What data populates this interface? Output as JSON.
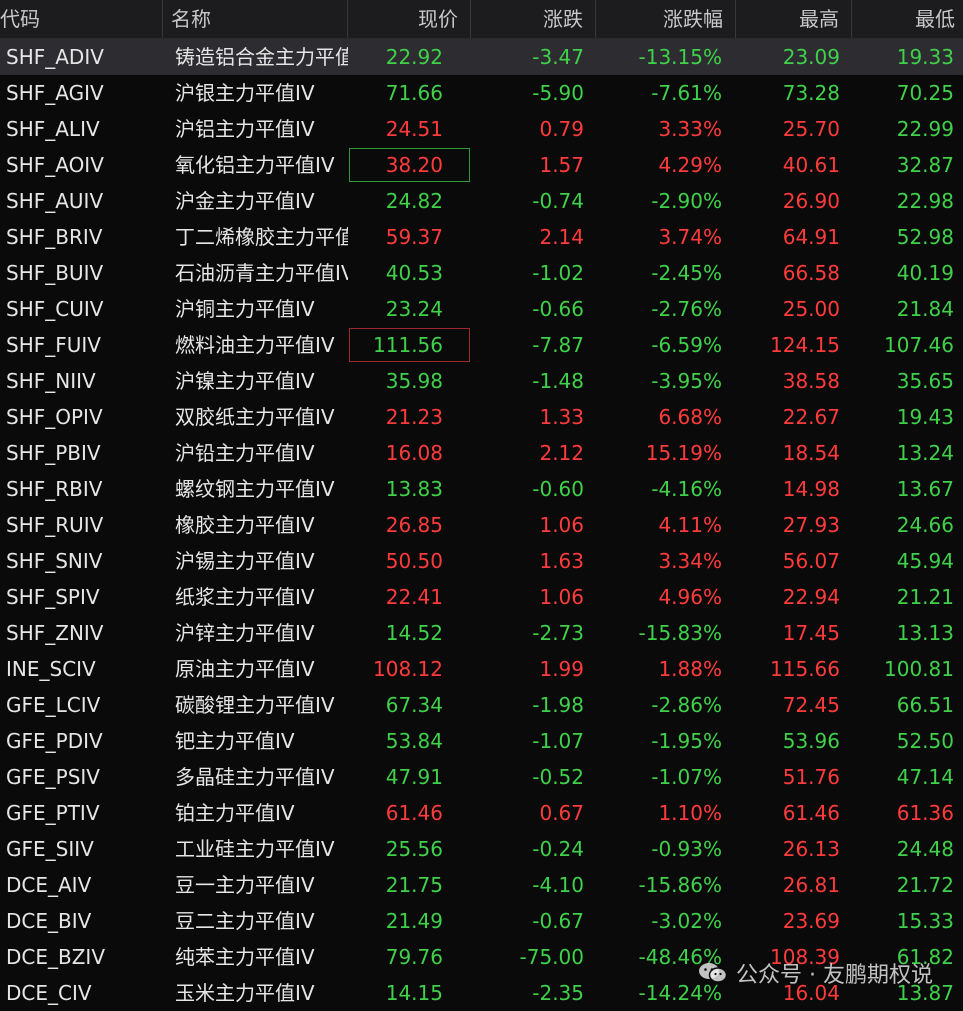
{
  "header": {
    "code": "代码",
    "name": "名称",
    "price": "现价",
    "change": "涨跌",
    "pct": "涨跌幅",
    "high": "最高",
    "low": "最低"
  },
  "rows": [
    {
      "code": "SHF_ADIV",
      "name": "铸造铝合金主力平值",
      "price": "22.92",
      "change": "-3.47",
      "pct": "-13.15%",
      "high": "23.09",
      "low": "19.33",
      "dir": "dn",
      "high_dir": "dn",
      "low_dir": "dn"
    },
    {
      "code": "SHF_AGIV",
      "name": "沪银主力平值IV",
      "price": "71.66",
      "change": "-5.90",
      "pct": "-7.61%",
      "high": "73.28",
      "low": "70.25",
      "dir": "dn",
      "high_dir": "dn",
      "low_dir": "dn"
    },
    {
      "code": "SHF_ALIV",
      "name": "沪铝主力平值IV",
      "price": "24.51",
      "change": "0.79",
      "pct": "3.33%",
      "high": "25.70",
      "low": "22.99",
      "dir": "up",
      "high_dir": "up",
      "low_dir": "dn"
    },
    {
      "code": "SHF_AOIV",
      "name": "氧化铝主力平值IV",
      "price": "38.20",
      "change": "1.57",
      "pct": "4.29%",
      "high": "40.61",
      "low": "32.87",
      "dir": "up",
      "high_dir": "up",
      "low_dir": "dn"
    },
    {
      "code": "SHF_AUIV",
      "name": "沪金主力平值IV",
      "price": "24.82",
      "change": "-0.74",
      "pct": "-2.90%",
      "high": "26.90",
      "low": "22.98",
      "dir": "dn",
      "high_dir": "up",
      "low_dir": "dn"
    },
    {
      "code": "SHF_BRIV",
      "name": "丁二烯橡胶主力平值",
      "price": "59.37",
      "change": "2.14",
      "pct": "3.74%",
      "high": "64.91",
      "low": "52.98",
      "dir": "up",
      "high_dir": "up",
      "low_dir": "dn"
    },
    {
      "code": "SHF_BUIV",
      "name": "石油沥青主力平值IV",
      "price": "40.53",
      "change": "-1.02",
      "pct": "-2.45%",
      "high": "66.58",
      "low": "40.19",
      "dir": "dn",
      "high_dir": "up",
      "low_dir": "dn"
    },
    {
      "code": "SHF_CUIV",
      "name": "沪铜主力平值IV",
      "price": "23.24",
      "change": "-0.66",
      "pct": "-2.76%",
      "high": "25.00",
      "low": "21.84",
      "dir": "dn",
      "high_dir": "up",
      "low_dir": "dn"
    },
    {
      "code": "SHF_FUIV",
      "name": "燃料油主力平值IV",
      "price": "111.56",
      "change": "-7.87",
      "pct": "-6.59%",
      "high": "124.15",
      "low": "107.46",
      "dir": "dn",
      "high_dir": "up",
      "low_dir": "dn"
    },
    {
      "code": "SHF_NIIV",
      "name": "沪镍主力平值IV",
      "price": "35.98",
      "change": "-1.48",
      "pct": "-3.95%",
      "high": "38.58",
      "low": "35.65",
      "dir": "dn",
      "high_dir": "up",
      "low_dir": "dn"
    },
    {
      "code": "SHF_OPIV",
      "name": "双胶纸主力平值IV",
      "price": "21.23",
      "change": "1.33",
      "pct": "6.68%",
      "high": "22.67",
      "low": "19.43",
      "dir": "up",
      "high_dir": "up",
      "low_dir": "dn"
    },
    {
      "code": "SHF_PBIV",
      "name": "沪铅主力平值IV",
      "price": "16.08",
      "change": "2.12",
      "pct": "15.19%",
      "high": "18.54",
      "low": "13.24",
      "dir": "up",
      "high_dir": "up",
      "low_dir": "dn"
    },
    {
      "code": "SHF_RBIV",
      "name": "螺纹钢主力平值IV",
      "price": "13.83",
      "change": "-0.60",
      "pct": "-4.16%",
      "high": "14.98",
      "low": "13.67",
      "dir": "dn",
      "high_dir": "up",
      "low_dir": "dn"
    },
    {
      "code": "SHF_RUIV",
      "name": "橡胶主力平值IV",
      "price": "26.85",
      "change": "1.06",
      "pct": "4.11%",
      "high": "27.93",
      "low": "24.66",
      "dir": "up",
      "high_dir": "up",
      "low_dir": "dn"
    },
    {
      "code": "SHF_SNIV",
      "name": "沪锡主力平值IV",
      "price": "50.50",
      "change": "1.63",
      "pct": "3.34%",
      "high": "56.07",
      "low": "45.94",
      "dir": "up",
      "high_dir": "up",
      "low_dir": "dn"
    },
    {
      "code": "SHF_SPIV",
      "name": "纸浆主力平值IV",
      "price": "22.41",
      "change": "1.06",
      "pct": "4.96%",
      "high": "22.94",
      "low": "21.21",
      "dir": "up",
      "high_dir": "up",
      "low_dir": "dn"
    },
    {
      "code": "SHF_ZNIV",
      "name": "沪锌主力平值IV",
      "price": "14.52",
      "change": "-2.73",
      "pct": "-15.83%",
      "high": "17.45",
      "low": "13.13",
      "dir": "dn",
      "high_dir": "up",
      "low_dir": "dn"
    },
    {
      "code": "INE_SCIV",
      "name": "原油主力平值IV",
      "price": "108.12",
      "change": "1.99",
      "pct": "1.88%",
      "high": "115.66",
      "low": "100.81",
      "dir": "up",
      "high_dir": "up",
      "low_dir": "dn"
    },
    {
      "code": "GFE_LCIV",
      "name": "碳酸锂主力平值IV",
      "price": "67.34",
      "change": "-1.98",
      "pct": "-2.86%",
      "high": "72.45",
      "low": "66.51",
      "dir": "dn",
      "high_dir": "up",
      "low_dir": "dn"
    },
    {
      "code": "GFE_PDIV",
      "name": "钯主力平值IV",
      "price": "53.84",
      "change": "-1.07",
      "pct": "-1.95%",
      "high": "53.96",
      "low": "52.50",
      "dir": "dn",
      "high_dir": "dn",
      "low_dir": "dn"
    },
    {
      "code": "GFE_PSIV",
      "name": "多晶硅主力平值IV",
      "price": "47.91",
      "change": "-0.52",
      "pct": "-1.07%",
      "high": "51.76",
      "low": "47.14",
      "dir": "dn",
      "high_dir": "up",
      "low_dir": "dn"
    },
    {
      "code": "GFE_PTIV",
      "name": "铂主力平值IV",
      "price": "61.46",
      "change": "0.67",
      "pct": "1.10%",
      "high": "61.46",
      "low": "61.36",
      "dir": "up",
      "high_dir": "up",
      "low_dir": "up"
    },
    {
      "code": "GFE_SIIV",
      "name": "工业硅主力平值IV",
      "price": "25.56",
      "change": "-0.24",
      "pct": "-0.93%",
      "high": "26.13",
      "low": "24.48",
      "dir": "dn",
      "high_dir": "up",
      "low_dir": "dn"
    },
    {
      "code": "DCE_AIV",
      "name": "豆一主力平值IV",
      "price": "21.75",
      "change": "-4.10",
      "pct": "-15.86%",
      "high": "26.81",
      "low": "21.72",
      "dir": "dn",
      "high_dir": "up",
      "low_dir": "dn"
    },
    {
      "code": "DCE_BIV",
      "name": "豆二主力平值IV",
      "price": "21.49",
      "change": "-0.67",
      "pct": "-3.02%",
      "high": "23.69",
      "low": "15.33",
      "dir": "dn",
      "high_dir": "up",
      "low_dir": "dn"
    },
    {
      "code": "DCE_BZIV",
      "name": "纯苯主力平值IV",
      "price": "79.76",
      "change": "-75.00",
      "pct": "-48.46%",
      "high": "108.39",
      "low": "61.82",
      "dir": "dn",
      "high_dir": "up",
      "low_dir": "dn"
    },
    {
      "code": "DCE_CIV",
      "name": "玉米主力平值IV",
      "price": "14.15",
      "change": "-2.35",
      "pct": "-14.24%",
      "high": "16.04",
      "low": "13.87",
      "dir": "dn",
      "high_dir": "up",
      "low_dir": "dn"
    }
  ],
  "selected_row": 0,
  "boxed": [
    {
      "row": 3,
      "color": "green"
    },
    {
      "row": 8,
      "color": "red"
    }
  ],
  "watermark": {
    "text": "公众号 · 友鹏期权说",
    "icon": "wechat-icon"
  },
  "colors": {
    "up": "#ff3b3b",
    "down": "#3fd14a",
    "background": "#0a0a0a",
    "header": "#1c1c1f"
  }
}
